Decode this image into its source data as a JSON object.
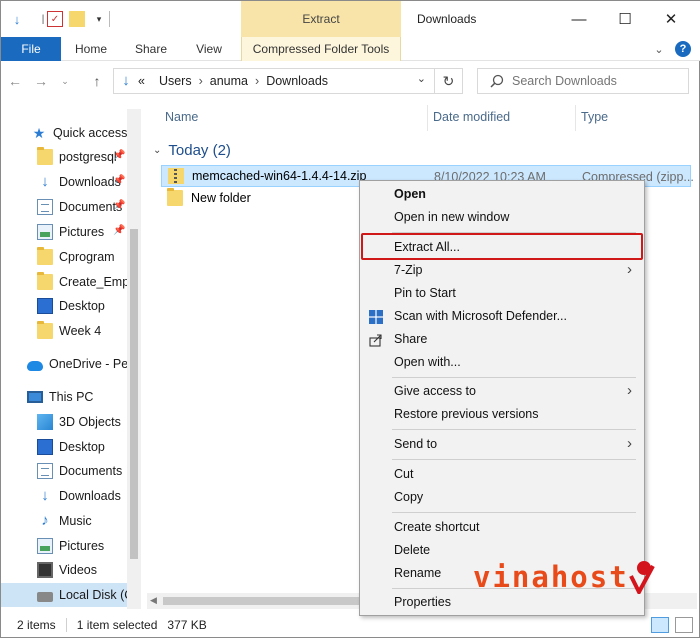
{
  "titlebar": {
    "contextual_tab": "Extract",
    "window_title": "Downloads",
    "quick_access_icons": [
      "download-arrow-icon",
      "properties-check-icon",
      "new-folder-icon",
      "customize-dropdown-icon"
    ]
  },
  "ribbon": {
    "tabs": [
      "File",
      "Home",
      "Share",
      "View",
      "Compressed Folder Tools"
    ]
  },
  "address": {
    "overflow": "«",
    "crumbs": [
      "Users",
      "anuma",
      "Downloads"
    ]
  },
  "search": {
    "placeholder": "Search Downloads"
  },
  "nav": {
    "items": [
      {
        "label": "Quick access",
        "icon": "star-icon"
      },
      {
        "label": "postgresql",
        "icon": "folder-icon",
        "pinned": true
      },
      {
        "label": "Downloads",
        "icon": "download-icon",
        "pinned": true
      },
      {
        "label": "Documents",
        "icon": "document-icon",
        "pinned": true
      },
      {
        "label": "Pictures",
        "icon": "picture-icon",
        "pinned": true
      },
      {
        "label": "Cprogram",
        "icon": "folder-icon"
      },
      {
        "label": "Create_Empty",
        "icon": "folder-icon"
      },
      {
        "label": "Desktop",
        "icon": "desktop-icon"
      },
      {
        "label": "Week 4",
        "icon": "folder-icon"
      },
      {
        "label": "OneDrive - Personal",
        "icon": "cloud-icon"
      },
      {
        "label": "This PC",
        "icon": "computer-icon"
      },
      {
        "label": "3D Objects",
        "icon": "cube-icon"
      },
      {
        "label": "Desktop",
        "icon": "desktop-icon"
      },
      {
        "label": "Documents",
        "icon": "document-icon"
      },
      {
        "label": "Downloads",
        "icon": "download-icon"
      },
      {
        "label": "Music",
        "icon": "music-icon"
      },
      {
        "label": "Pictures",
        "icon": "picture-icon"
      },
      {
        "label": "Videos",
        "icon": "video-icon"
      },
      {
        "label": "Local Disk (C:)",
        "icon": "disk-icon"
      }
    ]
  },
  "columns": [
    "Name",
    "Date modified",
    "Type"
  ],
  "group": {
    "label": "Today (2)"
  },
  "files": [
    {
      "name": "memcached-win64-1.4.4-14.zip",
      "date": "8/10/2022 10:23 AM",
      "type": "Compressed (zipp...",
      "selected": true
    },
    {
      "name": "New folder",
      "date": "",
      "type": "",
      "selected": false
    }
  ],
  "context_menu": {
    "items": [
      {
        "label": "Open",
        "bold": true
      },
      {
        "label": "Open in new window"
      },
      {
        "label": "Extract All...",
        "highlighted": true
      },
      {
        "label": "7-Zip",
        "submenu": true
      },
      {
        "label": "Pin to Start"
      },
      {
        "label": "Scan with Microsoft Defender...",
        "icon": "defender-icon"
      },
      {
        "label": "Share",
        "icon": "share-icon"
      },
      {
        "label": "Open with..."
      },
      {
        "label": "Give access to",
        "submenu": true
      },
      {
        "label": "Restore previous versions"
      },
      {
        "label": "Send to",
        "submenu": true
      },
      {
        "label": "Cut"
      },
      {
        "label": "Copy"
      },
      {
        "label": "Create shortcut"
      },
      {
        "label": "Delete"
      },
      {
        "label": "Rename"
      },
      {
        "label": "Properties"
      }
    ]
  },
  "status": {
    "item_count": "2 items",
    "selection": "1 item selected",
    "size": "377 KB"
  },
  "watermark": {
    "text": "vinahost",
    "color": "#e84a1a"
  }
}
